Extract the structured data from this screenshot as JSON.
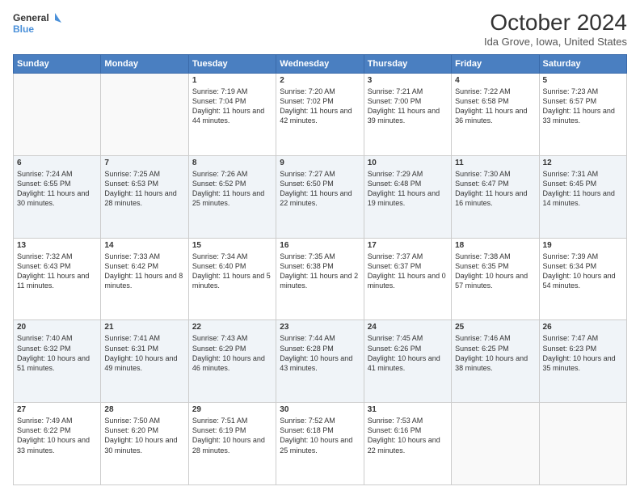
{
  "header": {
    "logo_line1": "General",
    "logo_line2": "Blue",
    "title": "October 2024",
    "subtitle": "Ida Grove, Iowa, United States"
  },
  "days_of_week": [
    "Sunday",
    "Monday",
    "Tuesday",
    "Wednesday",
    "Thursday",
    "Friday",
    "Saturday"
  ],
  "weeks": [
    [
      {
        "day": "",
        "sunrise": "",
        "sunset": "",
        "daylight": ""
      },
      {
        "day": "",
        "sunrise": "",
        "sunset": "",
        "daylight": ""
      },
      {
        "day": "1",
        "sunrise": "Sunrise: 7:19 AM",
        "sunset": "Sunset: 7:04 PM",
        "daylight": "Daylight: 11 hours and 44 minutes."
      },
      {
        "day": "2",
        "sunrise": "Sunrise: 7:20 AM",
        "sunset": "Sunset: 7:02 PM",
        "daylight": "Daylight: 11 hours and 42 minutes."
      },
      {
        "day": "3",
        "sunrise": "Sunrise: 7:21 AM",
        "sunset": "Sunset: 7:00 PM",
        "daylight": "Daylight: 11 hours and 39 minutes."
      },
      {
        "day": "4",
        "sunrise": "Sunrise: 7:22 AM",
        "sunset": "Sunset: 6:58 PM",
        "daylight": "Daylight: 11 hours and 36 minutes."
      },
      {
        "day": "5",
        "sunrise": "Sunrise: 7:23 AM",
        "sunset": "Sunset: 6:57 PM",
        "daylight": "Daylight: 11 hours and 33 minutes."
      }
    ],
    [
      {
        "day": "6",
        "sunrise": "Sunrise: 7:24 AM",
        "sunset": "Sunset: 6:55 PM",
        "daylight": "Daylight: 11 hours and 30 minutes."
      },
      {
        "day": "7",
        "sunrise": "Sunrise: 7:25 AM",
        "sunset": "Sunset: 6:53 PM",
        "daylight": "Daylight: 11 hours and 28 minutes."
      },
      {
        "day": "8",
        "sunrise": "Sunrise: 7:26 AM",
        "sunset": "Sunset: 6:52 PM",
        "daylight": "Daylight: 11 hours and 25 minutes."
      },
      {
        "day": "9",
        "sunrise": "Sunrise: 7:27 AM",
        "sunset": "Sunset: 6:50 PM",
        "daylight": "Daylight: 11 hours and 22 minutes."
      },
      {
        "day": "10",
        "sunrise": "Sunrise: 7:29 AM",
        "sunset": "Sunset: 6:48 PM",
        "daylight": "Daylight: 11 hours and 19 minutes."
      },
      {
        "day": "11",
        "sunrise": "Sunrise: 7:30 AM",
        "sunset": "Sunset: 6:47 PM",
        "daylight": "Daylight: 11 hours and 16 minutes."
      },
      {
        "day": "12",
        "sunrise": "Sunrise: 7:31 AM",
        "sunset": "Sunset: 6:45 PM",
        "daylight": "Daylight: 11 hours and 14 minutes."
      }
    ],
    [
      {
        "day": "13",
        "sunrise": "Sunrise: 7:32 AM",
        "sunset": "Sunset: 6:43 PM",
        "daylight": "Daylight: 11 hours and 11 minutes."
      },
      {
        "day": "14",
        "sunrise": "Sunrise: 7:33 AM",
        "sunset": "Sunset: 6:42 PM",
        "daylight": "Daylight: 11 hours and 8 minutes."
      },
      {
        "day": "15",
        "sunrise": "Sunrise: 7:34 AM",
        "sunset": "Sunset: 6:40 PM",
        "daylight": "Daylight: 11 hours and 5 minutes."
      },
      {
        "day": "16",
        "sunrise": "Sunrise: 7:35 AM",
        "sunset": "Sunset: 6:38 PM",
        "daylight": "Daylight: 11 hours and 2 minutes."
      },
      {
        "day": "17",
        "sunrise": "Sunrise: 7:37 AM",
        "sunset": "Sunset: 6:37 PM",
        "daylight": "Daylight: 11 hours and 0 minutes."
      },
      {
        "day": "18",
        "sunrise": "Sunrise: 7:38 AM",
        "sunset": "Sunset: 6:35 PM",
        "daylight": "Daylight: 10 hours and 57 minutes."
      },
      {
        "day": "19",
        "sunrise": "Sunrise: 7:39 AM",
        "sunset": "Sunset: 6:34 PM",
        "daylight": "Daylight: 10 hours and 54 minutes."
      }
    ],
    [
      {
        "day": "20",
        "sunrise": "Sunrise: 7:40 AM",
        "sunset": "Sunset: 6:32 PM",
        "daylight": "Daylight: 10 hours and 51 minutes."
      },
      {
        "day": "21",
        "sunrise": "Sunrise: 7:41 AM",
        "sunset": "Sunset: 6:31 PM",
        "daylight": "Daylight: 10 hours and 49 minutes."
      },
      {
        "day": "22",
        "sunrise": "Sunrise: 7:43 AM",
        "sunset": "Sunset: 6:29 PM",
        "daylight": "Daylight: 10 hours and 46 minutes."
      },
      {
        "day": "23",
        "sunrise": "Sunrise: 7:44 AM",
        "sunset": "Sunset: 6:28 PM",
        "daylight": "Daylight: 10 hours and 43 minutes."
      },
      {
        "day": "24",
        "sunrise": "Sunrise: 7:45 AM",
        "sunset": "Sunset: 6:26 PM",
        "daylight": "Daylight: 10 hours and 41 minutes."
      },
      {
        "day": "25",
        "sunrise": "Sunrise: 7:46 AM",
        "sunset": "Sunset: 6:25 PM",
        "daylight": "Daylight: 10 hours and 38 minutes."
      },
      {
        "day": "26",
        "sunrise": "Sunrise: 7:47 AM",
        "sunset": "Sunset: 6:23 PM",
        "daylight": "Daylight: 10 hours and 35 minutes."
      }
    ],
    [
      {
        "day": "27",
        "sunrise": "Sunrise: 7:49 AM",
        "sunset": "Sunset: 6:22 PM",
        "daylight": "Daylight: 10 hours and 33 minutes."
      },
      {
        "day": "28",
        "sunrise": "Sunrise: 7:50 AM",
        "sunset": "Sunset: 6:20 PM",
        "daylight": "Daylight: 10 hours and 30 minutes."
      },
      {
        "day": "29",
        "sunrise": "Sunrise: 7:51 AM",
        "sunset": "Sunset: 6:19 PM",
        "daylight": "Daylight: 10 hours and 28 minutes."
      },
      {
        "day": "30",
        "sunrise": "Sunrise: 7:52 AM",
        "sunset": "Sunset: 6:18 PM",
        "daylight": "Daylight: 10 hours and 25 minutes."
      },
      {
        "day": "31",
        "sunrise": "Sunrise: 7:53 AM",
        "sunset": "Sunset: 6:16 PM",
        "daylight": "Daylight: 10 hours and 22 minutes."
      },
      {
        "day": "",
        "sunrise": "",
        "sunset": "",
        "daylight": ""
      },
      {
        "day": "",
        "sunrise": "",
        "sunset": "",
        "daylight": ""
      }
    ]
  ]
}
